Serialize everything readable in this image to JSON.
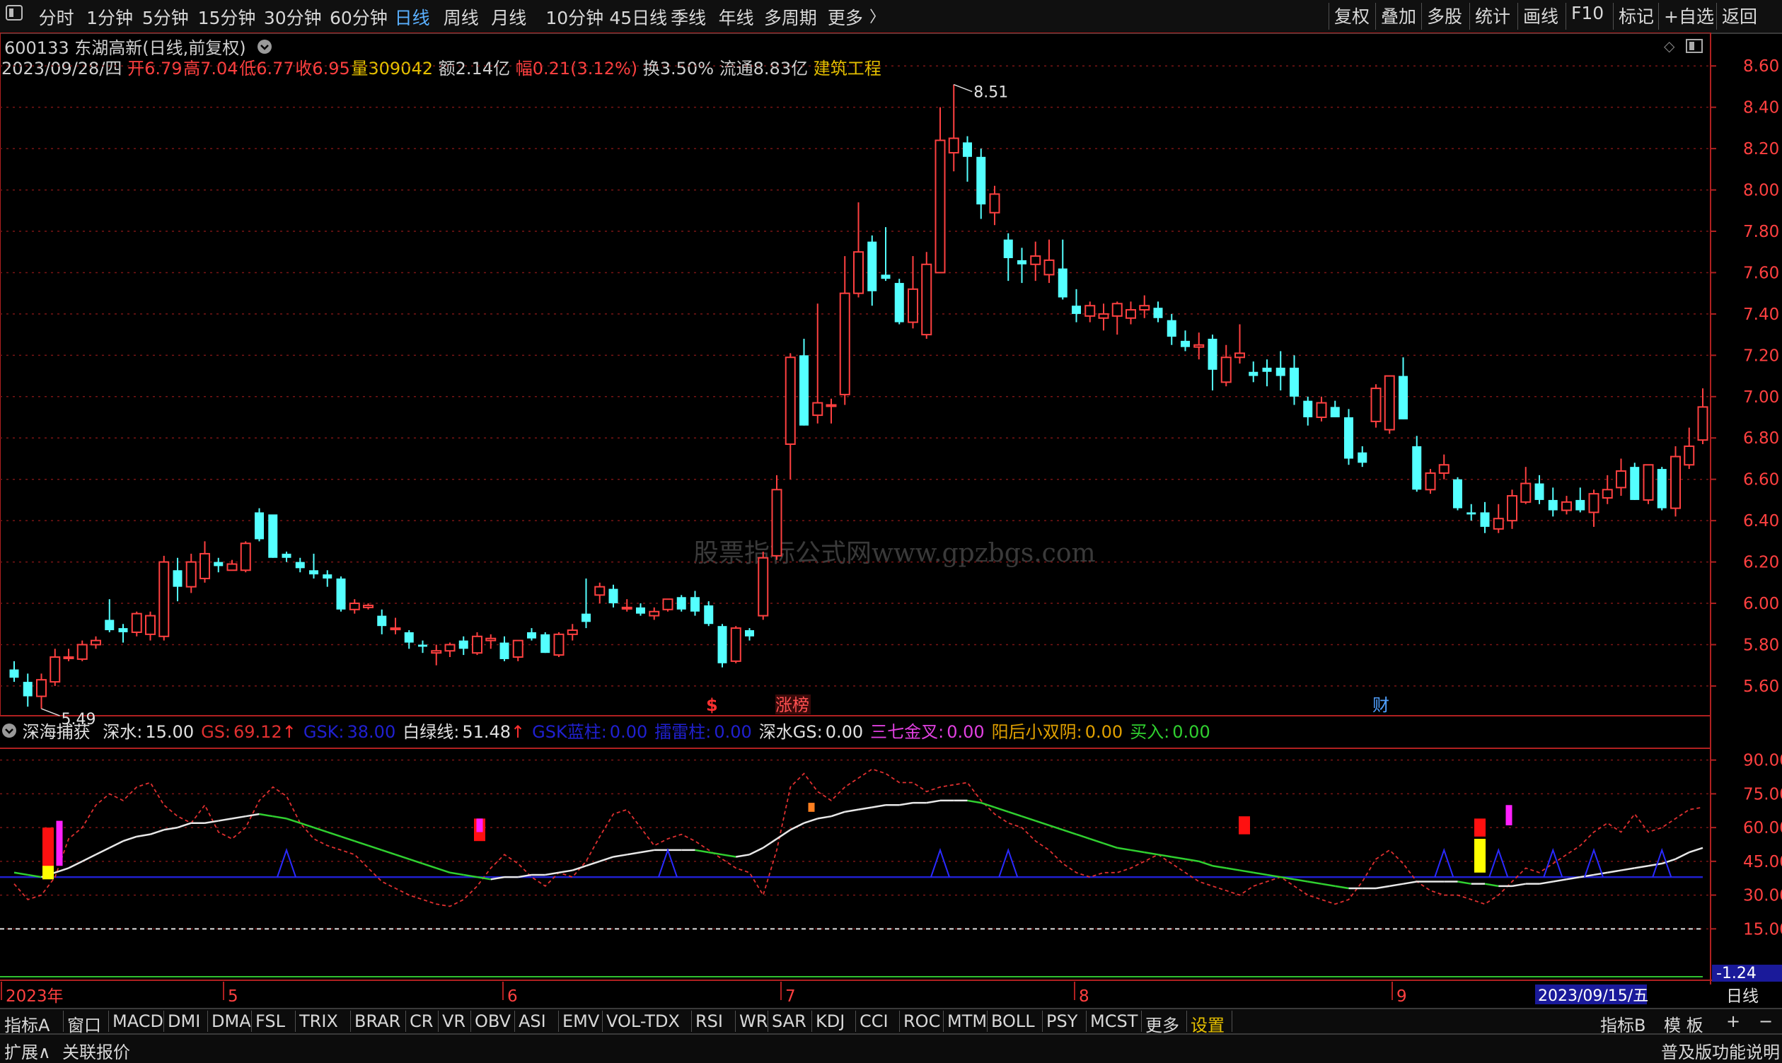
{
  "toolbar": {
    "menu_icon": "menu-icon",
    "periods": [
      "分时",
      "1分钟",
      "5分钟",
      "15分钟",
      "30分钟",
      "60分钟",
      "日线",
      "周线",
      "月线",
      "10分钟",
      "45日线",
      "季线",
      "年线",
      "多周期",
      "更多"
    ],
    "active_period": "日线",
    "right_buttons": [
      "复权",
      "叠加",
      "多股",
      "统计",
      "画线",
      "F10",
      "标记",
      "+自选",
      "返回"
    ]
  },
  "stock": {
    "title": "600133 东湖高新(日线,前复权)",
    "date": "2023/09/28/四",
    "open_label": "开",
    "open": "6.79",
    "high_label": "高",
    "high": "7.04",
    "low_label": "低",
    "low": "6.77",
    "close_label": "收",
    "close": "6.95",
    "vol_label": "量",
    "vol": "309042",
    "amount_label": "额",
    "amount": "2.14亿",
    "change_label": "幅",
    "change": "0.21(3.12%)",
    "turnover_label": "换",
    "turnover": "3.50%",
    "float_label": "流通",
    "float": "8.83亿",
    "sector": "建筑工程"
  },
  "markers": {
    "dollar": "$",
    "zhangbang": "涨榜",
    "cai": "财",
    "high_label": "8.51",
    "low_label": "5.49"
  },
  "indicator": {
    "name": "深海捕获",
    "items": [
      {
        "label": "深水:",
        "value": "15.00",
        "color": "#e0e0e0"
      },
      {
        "label": "GS:",
        "value": "69.12",
        "color": "#e03030",
        "arrow": "↑"
      },
      {
        "label": "GSK:",
        "value": "38.00",
        "color": "#2020d0"
      },
      {
        "label": "白绿线:",
        "value": "51.48",
        "color": "#e0e0e0",
        "arrow": "↑"
      },
      {
        "label": "GSK蓝柱:",
        "value": "0.00",
        "color": "#2020d0"
      },
      {
        "label": "擂雷柱:",
        "value": "0.00",
        "color": "#2020d0"
      },
      {
        "label": "深水GS:",
        "value": "0.00",
        "color": "#e0e0e0"
      },
      {
        "label": "三七金叉:",
        "value": "0.00",
        "color": "#e040e0"
      },
      {
        "label": "阳后小双阴:",
        "value": "0.00",
        "color": "#e0a000"
      },
      {
        "label": "买入:",
        "value": "0.00",
        "color": "#30d030"
      }
    ],
    "right_value": "-1.24"
  },
  "time_axis": {
    "labels": [
      "2023年",
      "5",
      "6",
      "7",
      "8",
      "9"
    ],
    "cursor_date": "2023/09/15/五",
    "period": "日线"
  },
  "bottom_tabs": [
    "指标A",
    "窗口",
    "MACD",
    "DMI",
    "DMA",
    "FSL",
    "TRIX",
    "BRAR",
    "CR",
    "VR",
    "OBV",
    "ASI",
    "EMV",
    "VOL-TDX",
    "RSI",
    "WR",
    "SAR",
    "KDJ",
    "CCI",
    "ROC",
    "MTM",
    "BOLL",
    "PSY",
    "MCST",
    "更多",
    "设置"
  ],
  "bottom_right": [
    "指标B",
    "模 板",
    "+",
    "−"
  ],
  "status": {
    "left1": "扩展∧",
    "left2": "关联报价",
    "right": "普及版功能说明"
  },
  "watermark": "股票指标公式网www.gpzbgs.com",
  "colors": {
    "up": "#ff4040",
    "down": "#54ffff",
    "axis": "#b02020"
  },
  "chart_data": [
    {
      "type": "candlestick",
      "title": "600133 东湖高新(日线,前复权)",
      "ylim": [
        5.48,
        8.7
      ],
      "yticks": [
        "8.60",
        "8.40",
        "8.20",
        "8.00",
        "7.80",
        "7.60",
        "7.40",
        "7.20",
        "7.00",
        "6.80",
        "6.60",
        "6.40",
        "6.20",
        "6.00",
        "5.80",
        "5.60"
      ],
      "ohlc": [
        [
          5.68,
          5.72,
          5.62,
          5.64
        ],
        [
          5.62,
          5.66,
          5.5,
          5.55
        ],
        [
          5.55,
          5.66,
          5.49,
          5.63
        ],
        [
          5.62,
          5.78,
          5.6,
          5.74
        ],
        [
          5.74,
          5.78,
          5.72,
          5.74
        ],
        [
          5.73,
          5.82,
          5.72,
          5.8
        ],
        [
          5.8,
          5.84,
          5.78,
          5.82
        ],
        [
          5.92,
          6.02,
          5.86,
          5.87
        ],
        [
          5.88,
          5.9,
          5.81,
          5.86
        ],
        [
          5.86,
          5.96,
          5.84,
          5.95
        ],
        [
          5.85,
          5.96,
          5.82,
          5.94
        ],
        [
          5.84,
          6.23,
          5.82,
          6.2
        ],
        [
          6.16,
          6.22,
          6.01,
          6.08
        ],
        [
          6.08,
          6.24,
          6.05,
          6.2
        ],
        [
          6.12,
          6.3,
          6.1,
          6.24
        ],
        [
          6.2,
          6.22,
          6.15,
          6.18
        ],
        [
          6.16,
          6.21,
          6.16,
          6.19
        ],
        [
          6.16,
          6.3,
          6.15,
          6.29
        ],
        [
          6.44,
          6.46,
          6.3,
          6.31
        ],
        [
          6.43,
          6.4,
          6.22,
          6.22
        ],
        [
          6.24,
          6.25,
          6.2,
          6.22
        ],
        [
          6.2,
          6.22,
          6.15,
          6.17
        ],
        [
          6.16,
          6.24,
          6.12,
          6.14
        ],
        [
          6.14,
          6.16,
          6.08,
          6.12
        ],
        [
          6.12,
          6.13,
          5.96,
          5.97
        ],
        [
          5.97,
          6.02,
          5.95,
          6.0
        ],
        [
          5.98,
          6.0,
          5.97,
          5.99
        ],
        [
          5.94,
          5.97,
          5.85,
          5.89
        ],
        [
          5.88,
          5.93,
          5.85,
          5.88
        ],
        [
          5.86,
          5.87,
          5.78,
          5.81
        ],
        [
          5.8,
          5.82,
          5.76,
          5.79
        ],
        [
          5.76,
          5.8,
          5.7,
          5.77
        ],
        [
          5.77,
          5.81,
          5.74,
          5.8
        ],
        [
          5.82,
          5.84,
          5.75,
          5.78
        ],
        [
          5.76,
          5.86,
          5.75,
          5.84
        ],
        [
          5.82,
          5.85,
          5.78,
          5.83
        ],
        [
          5.81,
          5.84,
          5.72,
          5.73
        ],
        [
          5.74,
          5.82,
          5.72,
          5.82
        ],
        [
          5.86,
          5.88,
          5.82,
          5.83
        ],
        [
          5.85,
          5.86,
          5.76,
          5.76
        ],
        [
          5.75,
          5.86,
          5.74,
          5.85
        ],
        [
          5.85,
          5.9,
          5.82,
          5.87
        ],
        [
          5.95,
          6.12,
          5.88,
          5.91
        ],
        [
          6.04,
          6.1,
          6.0,
          6.08
        ],
        [
          6.07,
          6.09,
          5.98,
          6.0
        ],
        [
          5.98,
          6.02,
          5.96,
          5.98
        ],
        [
          5.98,
          6.0,
          5.94,
          5.95
        ],
        [
          5.94,
          5.98,
          5.92,
          5.96
        ],
        [
          5.97,
          6.02,
          5.96,
          6.02
        ],
        [
          6.03,
          6.04,
          5.96,
          5.97
        ],
        [
          6.03,
          6.06,
          5.94,
          5.96
        ],
        [
          5.99,
          6.01,
          5.89,
          5.9
        ],
        [
          5.89,
          5.9,
          5.69,
          5.71
        ],
        [
          5.72,
          5.89,
          5.71,
          5.88
        ],
        [
          5.87,
          5.88,
          5.82,
          5.84
        ],
        [
          5.94,
          6.25,
          5.92,
          6.22
        ],
        [
          6.23,
          6.62,
          6.21,
          6.55
        ],
        [
          6.77,
          7.21,
          6.6,
          7.19
        ],
        [
          7.2,
          7.28,
          6.86,
          6.86
        ],
        [
          6.91,
          7.45,
          6.87,
          6.97
        ],
        [
          6.96,
          6.99,
          6.87,
          6.96
        ],
        [
          7.01,
          7.68,
          6.96,
          7.5
        ],
        [
          7.5,
          7.94,
          7.48,
          7.7
        ],
        [
          7.75,
          7.78,
          7.44,
          7.51
        ],
        [
          7.59,
          7.82,
          7.56,
          7.57
        ],
        [
          7.55,
          7.57,
          7.35,
          7.36
        ],
        [
          7.36,
          7.68,
          7.33,
          7.52
        ],
        [
          7.3,
          7.7,
          7.28,
          7.64
        ],
        [
          7.6,
          8.4,
          7.62,
          8.24
        ],
        [
          8.18,
          8.51,
          8.09,
          8.25
        ],
        [
          8.23,
          8.26,
          8.04,
          8.16
        ],
        [
          8.16,
          8.2,
          7.86,
          7.93
        ],
        [
          7.89,
          8.02,
          7.83,
          7.98
        ],
        [
          7.76,
          7.79,
          7.56,
          7.67
        ],
        [
          7.66,
          7.72,
          7.55,
          7.64
        ],
        [
          7.64,
          7.75,
          7.56,
          7.68
        ],
        [
          7.59,
          7.76,
          7.55,
          7.66
        ],
        [
          7.62,
          7.76,
          7.47,
          7.48
        ],
        [
          7.44,
          7.52,
          7.36,
          7.4
        ],
        [
          7.39,
          7.46,
          7.36,
          7.44
        ],
        [
          7.38,
          7.45,
          7.32,
          7.4
        ],
        [
          7.39,
          7.46,
          7.3,
          7.45
        ],
        [
          7.38,
          7.46,
          7.35,
          7.42
        ],
        [
          7.42,
          7.49,
          7.38,
          7.44
        ],
        [
          7.43,
          7.46,
          7.36,
          7.38
        ],
        [
          7.37,
          7.4,
          7.25,
          7.29
        ],
        [
          7.27,
          7.32,
          7.22,
          7.24
        ],
        [
          7.24,
          7.31,
          7.18,
          7.25
        ],
        [
          7.28,
          7.3,
          7.03,
          7.13
        ],
        [
          7.07,
          7.25,
          7.05,
          7.19
        ],
        [
          7.19,
          7.35,
          7.16,
          7.21
        ],
        [
          7.12,
          7.17,
          7.07,
          7.1
        ],
        [
          7.14,
          7.18,
          7.05,
          7.12
        ],
        [
          7.14,
          7.22,
          7.03,
          7.1
        ],
        [
          7.14,
          7.2,
          6.96,
          7.0
        ],
        [
          6.98,
          7.0,
          6.86,
          6.9
        ],
        [
          6.9,
          7.0,
          6.88,
          6.97
        ],
        [
          6.95,
          6.98,
          6.9,
          6.9
        ],
        [
          6.9,
          6.94,
          6.67,
          6.7
        ],
        [
          6.73,
          6.76,
          6.66,
          6.68
        ],
        [
          6.88,
          7.06,
          6.85,
          7.04
        ],
        [
          6.84,
          7.1,
          6.82,
          7.1
        ],
        [
          7.1,
          7.19,
          6.89,
          6.89
        ],
        [
          6.76,
          6.81,
          6.54,
          6.55
        ],
        [
          6.55,
          6.65,
          6.53,
          6.63
        ],
        [
          6.63,
          6.72,
          6.6,
          6.67
        ],
        [
          6.6,
          6.61,
          6.45,
          6.46
        ],
        [
          6.44,
          6.48,
          6.4,
          6.43
        ],
        [
          6.44,
          6.49,
          6.34,
          6.37
        ],
        [
          6.36,
          6.48,
          6.34,
          6.41
        ],
        [
          6.4,
          6.55,
          6.36,
          6.52
        ],
        [
          6.49,
          6.66,
          6.48,
          6.58
        ],
        [
          6.58,
          6.62,
          6.48,
          6.5
        ],
        [
          6.5,
          6.56,
          6.42,
          6.45
        ],
        [
          6.45,
          6.52,
          6.43,
          6.49
        ],
        [
          6.5,
          6.56,
          6.44,
          6.45
        ],
        [
          6.44,
          6.55,
          6.37,
          6.53
        ],
        [
          6.51,
          6.62,
          6.48,
          6.55
        ],
        [
          6.56,
          6.7,
          6.52,
          6.64
        ],
        [
          6.66,
          6.68,
          6.5,
          6.5
        ],
        [
          6.5,
          6.67,
          6.48,
          6.67
        ],
        [
          6.65,
          6.66,
          6.45,
          6.46
        ],
        [
          6.46,
          6.76,
          6.42,
          6.71
        ],
        [
          6.67,
          6.85,
          6.65,
          6.76
        ],
        [
          6.79,
          7.04,
          6.77,
          6.95
        ]
      ]
    },
    {
      "type": "line",
      "title": "深海捕获",
      "ylim": [
        -1.24,
        99
      ],
      "yticks": [
        "90.00",
        "75.00",
        "60.00",
        "45.00",
        "30.00",
        "15.00"
      ],
      "series": [
        {
          "name": "GS",
          "color": "#e03030",
          "values": [
            35,
            28,
            30,
            38,
            55,
            60,
            70,
            75,
            72,
            78,
            80,
            70,
            65,
            62,
            70,
            58,
            55,
            60,
            72,
            78,
            74,
            62,
            55,
            52,
            50,
            48,
            42,
            36,
            33,
            30,
            28,
            26,
            25,
            28,
            34,
            42,
            48,
            44,
            38,
            34,
            40,
            38,
            45,
            56,
            66,
            68,
            60,
            52,
            55,
            57,
            54,
            50,
            46,
            42,
            40,
            30,
            50,
            78,
            84,
            76,
            72,
            78,
            82,
            86,
            84,
            80,
            80,
            76,
            78,
            79,
            80,
            72,
            66,
            62,
            60,
            54,
            50,
            44,
            40,
            38,
            40,
            40,
            42,
            45,
            48,
            44,
            40,
            36,
            34,
            32,
            30,
            34,
            36,
            38,
            34,
            30,
            28,
            26,
            28,
            36,
            46,
            50,
            44,
            36,
            32,
            30,
            30,
            28,
            26,
            30,
            36,
            42,
            40,
            44,
            48,
            52,
            58,
            62,
            58,
            66,
            58,
            60,
            64,
            68,
            69
          ]
        },
        {
          "name": "白绿线",
          "color": "#e8e8e8",
          "values": [
            40,
            39,
            38,
            40,
            42,
            45,
            48,
            51,
            54,
            56,
            57,
            59,
            60,
            62,
            62,
            63,
            64,
            65,
            66,
            65,
            64,
            62,
            60,
            58,
            56,
            54,
            52,
            50,
            48,
            46,
            44,
            42,
            40,
            39,
            38,
            37,
            38,
            38,
            39,
            39,
            40,
            41,
            43,
            45,
            47,
            48,
            49,
            50,
            50,
            50,
            50,
            49,
            48,
            47,
            48,
            51,
            55,
            59,
            62,
            64,
            65,
            67,
            68,
            69,
            70,
            70,
            71,
            71,
            72,
            72,
            72,
            71,
            69,
            67,
            65,
            63,
            61,
            59,
            57,
            55,
            53,
            51,
            50,
            49,
            48,
            47,
            46,
            45,
            43,
            42,
            41,
            40,
            39,
            38,
            37,
            36,
            35,
            34,
            33,
            33,
            33,
            34,
            35,
            36,
            36,
            36,
            36,
            35,
            35,
            34,
            34,
            35,
            35,
            36,
            37,
            38,
            39,
            40,
            41,
            42,
            43,
            44,
            46,
            49,
            51
          ]
        },
        {
          "name": "GSK",
          "color": "#2020d0",
          "values": [
            38,
            38
          ]
        },
        {
          "name": "深水",
          "color": "#e0e0e0",
          "values": [
            15,
            15
          ]
        }
      ]
    }
  ]
}
